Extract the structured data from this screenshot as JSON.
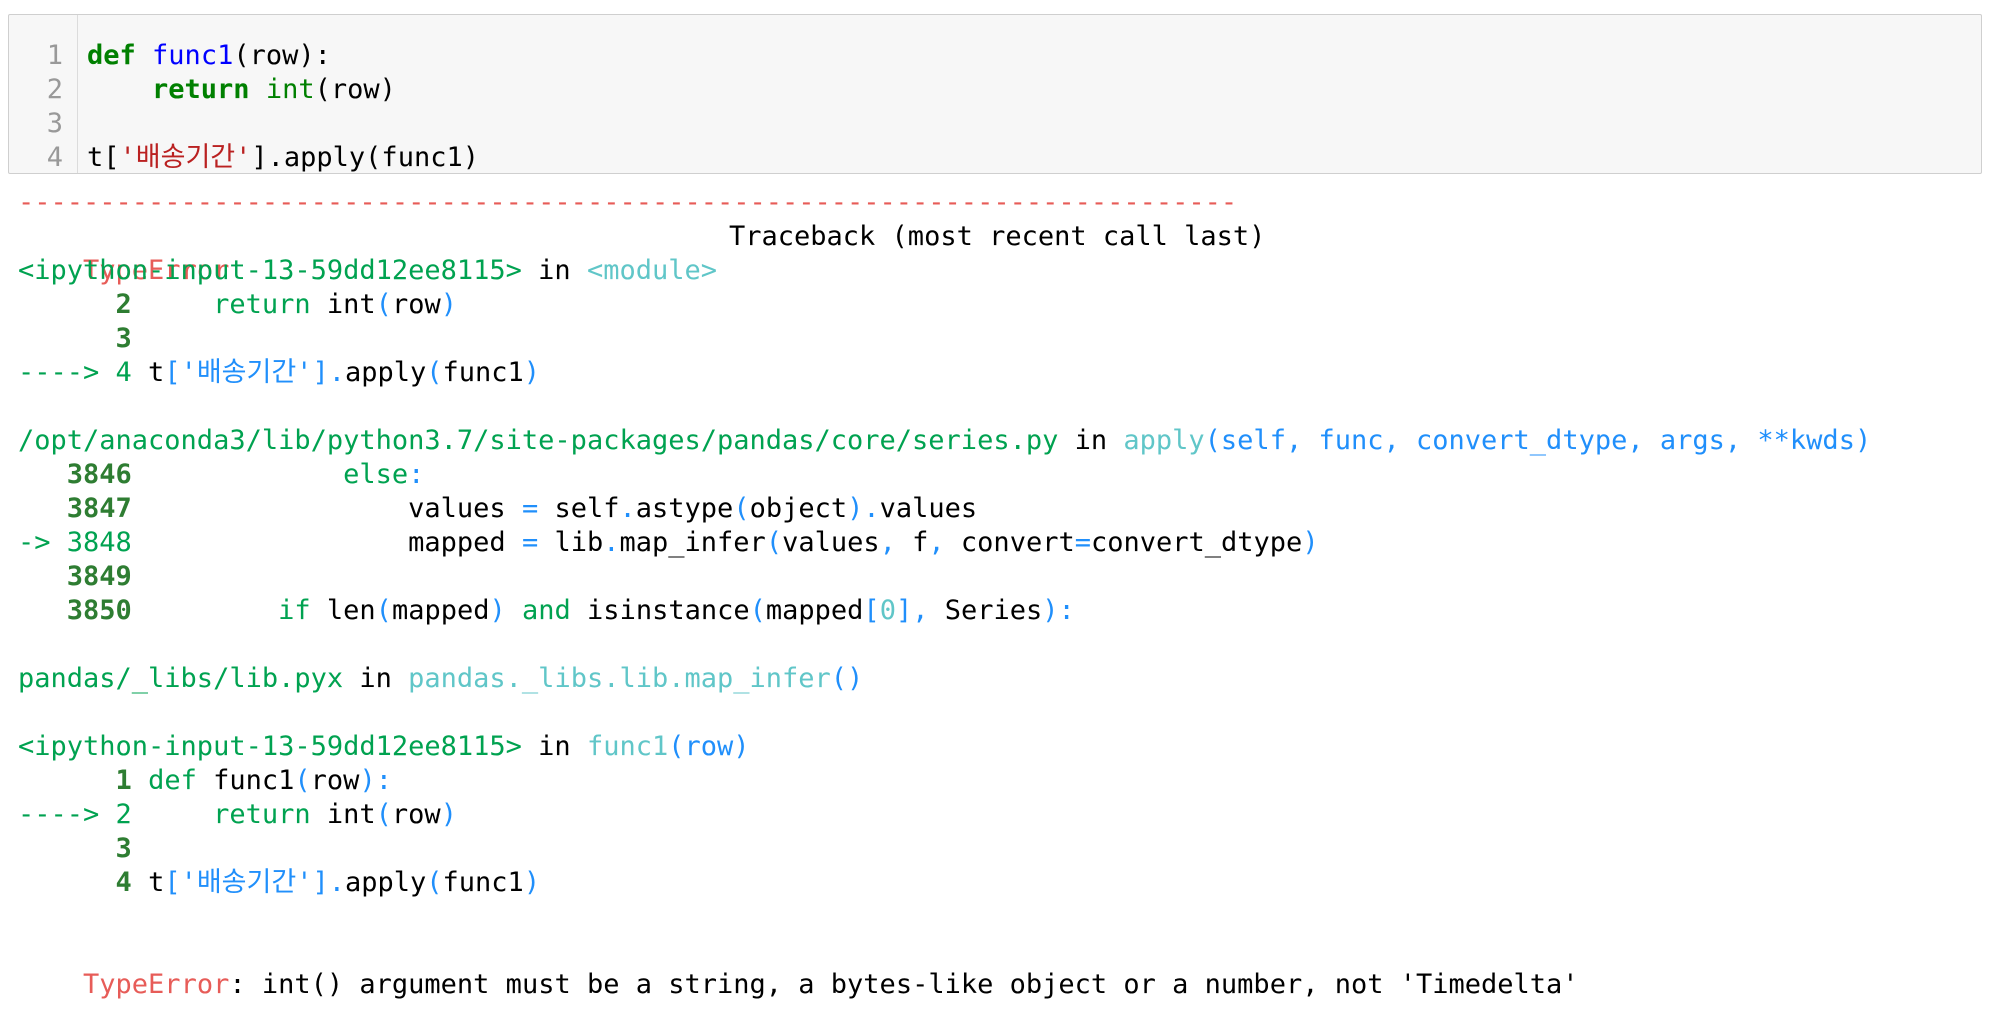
{
  "input_cell": {
    "lines": [
      {
        "no": "1",
        "parts": [
          [
            "def",
            "kw"
          ],
          [
            " ",
            ""
          ],
          [
            "func1",
            "fn"
          ],
          [
            "(row):",
            ""
          ]
        ]
      },
      {
        "no": "2",
        "parts": [
          [
            "    ",
            ""
          ],
          [
            "return",
            "kw"
          ],
          [
            " ",
            ""
          ],
          [
            "int",
            "bi"
          ],
          [
            "(row)",
            ""
          ]
        ]
      },
      {
        "no": "3",
        "parts": []
      },
      {
        "no": "4",
        "parts": [
          [
            "t[",
            ""
          ],
          [
            "'배송기간'",
            "str"
          ],
          [
            "].apply(func1)",
            ""
          ]
        ]
      }
    ]
  },
  "traceback": {
    "separator": "---------------------------------------------------------------------------",
    "header_error": "TypeError",
    "header_right": "Traceback (most recent call last)",
    "lines": [
      [
        [
          "<ipython-input-13-59dd12ee8115>",
          "grn"
        ],
        [
          " in ",
          "blk"
        ],
        [
          "<module>",
          "cyan"
        ]
      ],
      [
        [
          "      ",
          ""
        ],
        [
          "2",
          "grn-d bold"
        ],
        [
          "     ",
          ""
        ],
        [
          "return",
          "grn"
        ],
        [
          " int",
          "blk"
        ],
        [
          "(",
          "blue"
        ],
        [
          "row",
          "blk"
        ],
        [
          ")",
          "blue"
        ]
      ],
      [
        [
          "      ",
          ""
        ],
        [
          "3",
          "grn-d bold"
        ]
      ],
      [
        [
          "----> 4",
          "grn"
        ],
        [
          " t",
          "blk"
        ],
        [
          "['배송기간']",
          "blue"
        ],
        [
          ".",
          "blue"
        ],
        [
          "apply",
          "blk"
        ],
        [
          "(",
          "blue"
        ],
        [
          "func1",
          "blk"
        ],
        [
          ")",
          "blue"
        ]
      ],
      [],
      [
        [
          "/opt/anaconda3/lib/python3.7/site-packages/pandas/core/series.py",
          "grn"
        ],
        [
          " in ",
          "blk"
        ],
        [
          "apply",
          "cyan"
        ],
        [
          "(",
          "blue"
        ],
        [
          "self",
          "blue"
        ],
        [
          ", ",
          "blue"
        ],
        [
          "func",
          "blue"
        ],
        [
          ", ",
          "blue"
        ],
        [
          "convert_dtype",
          "blue"
        ],
        [
          ", ",
          "blue"
        ],
        [
          "args",
          "blue"
        ],
        [
          ", ",
          "blue"
        ],
        [
          "**",
          "blue"
        ],
        [
          "kwds",
          "blue"
        ],
        [
          ")",
          "blue"
        ]
      ],
      [
        [
          "   ",
          ""
        ],
        [
          "3846",
          "grn-d bold"
        ],
        [
          "             ",
          ""
        ],
        [
          "else",
          "grn"
        ],
        [
          ":",
          "blue"
        ]
      ],
      [
        [
          "   ",
          ""
        ],
        [
          "3847",
          "grn-d bold"
        ],
        [
          "                 values ",
          "blk"
        ],
        [
          "=",
          "blue"
        ],
        [
          " self",
          "blk"
        ],
        [
          ".",
          "blue"
        ],
        [
          "astype",
          "blk"
        ],
        [
          "(",
          "blue"
        ],
        [
          "object",
          "blk"
        ],
        [
          ")",
          "blue"
        ],
        [
          ".",
          "blue"
        ],
        [
          "values",
          "blk"
        ]
      ],
      [
        [
          "-> 3848",
          "grn"
        ],
        [
          "                 mapped ",
          "blk"
        ],
        [
          "=",
          "blue"
        ],
        [
          " lib",
          "blk"
        ],
        [
          ".",
          "blue"
        ],
        [
          "map_infer",
          "blk"
        ],
        [
          "(",
          "blue"
        ],
        [
          "values",
          "blk"
        ],
        [
          ", ",
          "blue"
        ],
        [
          "f",
          "blk"
        ],
        [
          ", ",
          "blue"
        ],
        [
          "convert",
          "blk"
        ],
        [
          "=",
          "blue"
        ],
        [
          "convert_dtype",
          "blk"
        ],
        [
          ")",
          "blue"
        ]
      ],
      [
        [
          "   ",
          ""
        ],
        [
          "3849",
          "grn-d bold"
        ]
      ],
      [
        [
          "   ",
          ""
        ],
        [
          "3850",
          "grn-d bold"
        ],
        [
          "         ",
          ""
        ],
        [
          "if",
          "grn"
        ],
        [
          " len",
          "blk"
        ],
        [
          "(",
          "blue"
        ],
        [
          "mapped",
          "blk"
        ],
        [
          ")",
          "blue"
        ],
        [
          " ",
          ""
        ],
        [
          "and",
          "grn"
        ],
        [
          " isinstance",
          "blk"
        ],
        [
          "(",
          "blue"
        ],
        [
          "mapped",
          "blk"
        ],
        [
          "[",
          "blue"
        ],
        [
          "0",
          "cyan"
        ],
        [
          "]",
          "blue"
        ],
        [
          ", ",
          "blue"
        ],
        [
          "Series",
          "blk"
        ],
        [
          "):",
          "blue"
        ]
      ],
      [],
      [
        [
          "pandas/_libs/lib.pyx",
          "grn"
        ],
        [
          " in ",
          "blk"
        ],
        [
          "pandas._libs.lib.map_infer",
          "cyan"
        ],
        [
          "()",
          "blue"
        ]
      ],
      [],
      [
        [
          "<ipython-input-13-59dd12ee8115>",
          "grn"
        ],
        [
          " in ",
          "blk"
        ],
        [
          "func1",
          "cyan"
        ],
        [
          "(",
          "blue"
        ],
        [
          "row",
          "blue"
        ],
        [
          ")",
          "blue"
        ]
      ],
      [
        [
          "      ",
          ""
        ],
        [
          "1",
          "grn-d bold"
        ],
        [
          " ",
          ""
        ],
        [
          "def",
          "grn"
        ],
        [
          " func1",
          "blk"
        ],
        [
          "(",
          "blue"
        ],
        [
          "row",
          "blk"
        ],
        [
          "):",
          "blue"
        ]
      ],
      [
        [
          "----> 2",
          "grn"
        ],
        [
          "     ",
          ""
        ],
        [
          "return",
          "grn"
        ],
        [
          " int",
          "blk"
        ],
        [
          "(",
          "blue"
        ],
        [
          "row",
          "blk"
        ],
        [
          ")",
          "blue"
        ]
      ],
      [
        [
          "      ",
          ""
        ],
        [
          "3",
          "grn-d bold"
        ]
      ],
      [
        [
          "      ",
          ""
        ],
        [
          "4",
          "grn-d bold"
        ],
        [
          " t",
          "blk"
        ],
        [
          "['배송기간']",
          "blue"
        ],
        [
          ".",
          "blue"
        ],
        [
          "apply",
          "blk"
        ],
        [
          "(",
          "blue"
        ],
        [
          "func1",
          "blk"
        ],
        [
          ")",
          "blue"
        ]
      ],
      []
    ],
    "final_error_type": "TypeError",
    "final_error_msg": ": int() argument must be a string, a bytes-like object or a number, not 'Timedelta'"
  }
}
